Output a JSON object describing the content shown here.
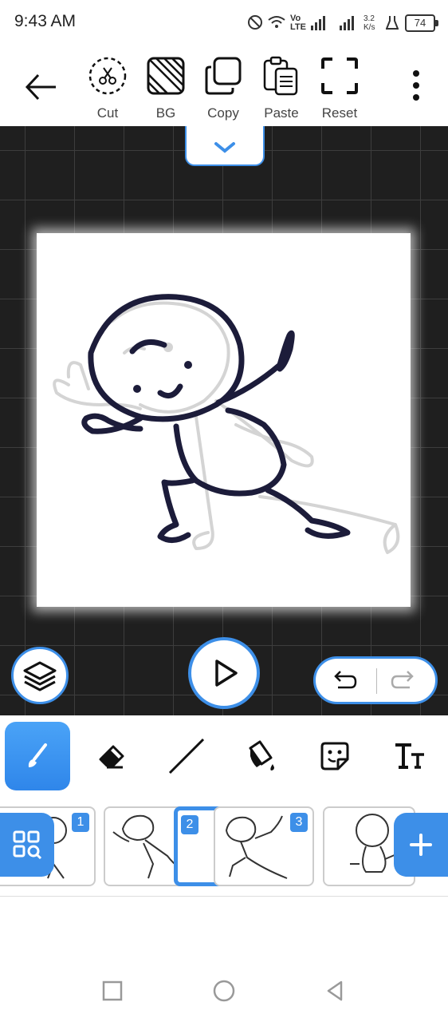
{
  "status_bar": {
    "time": "9:43 AM",
    "network_speed": "3.2 K/s",
    "network_type": "Vo LTE",
    "battery": "74"
  },
  "toolbar": {
    "cut_label": "Cut",
    "bg_label": "BG",
    "copy_label": "Copy",
    "paste_label": "Paste",
    "reset_label": "Reset"
  },
  "frames": [
    {
      "number": "1",
      "selected": false
    },
    {
      "number": "2",
      "selected": true
    },
    {
      "number": "3",
      "selected": false
    }
  ],
  "draw_tools": [
    "brush",
    "eraser",
    "line",
    "fill-bucket",
    "sticker",
    "text"
  ],
  "active_tool": "brush",
  "colors": {
    "accent": "#3d8fe8",
    "canvas_bg": "#1f1f1f",
    "stroke": "#1c1c3a"
  }
}
